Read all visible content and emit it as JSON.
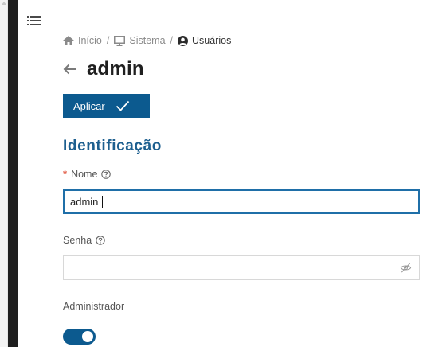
{
  "breadcrumb": {
    "items": [
      {
        "label": "Início",
        "icon": "home-icon"
      },
      {
        "label": "Sistema",
        "icon": "monitor-icon"
      },
      {
        "label": "Usuários",
        "icon": "user-circle-icon"
      }
    ],
    "separator": "/"
  },
  "header": {
    "title": "admin",
    "back_icon": "arrow-left-icon"
  },
  "toolbar": {
    "apply_label": "Aplicar",
    "apply_icon": "check-icon"
  },
  "section": {
    "title": "Identificação"
  },
  "form": {
    "name": {
      "label": "Nome",
      "required_marker": "*",
      "value": "admin"
    },
    "password": {
      "label": "Senha",
      "value": "",
      "visibility_icon": "eye-off-icon"
    },
    "admin": {
      "label": "Administrador",
      "enabled": true
    }
  },
  "colors": {
    "primary": "#0c5a8f",
    "section_title": "#1d5f8f",
    "required": "#e0533c",
    "focus_border": "#1f6fa8",
    "nav_rail": "#1f1f1f"
  }
}
